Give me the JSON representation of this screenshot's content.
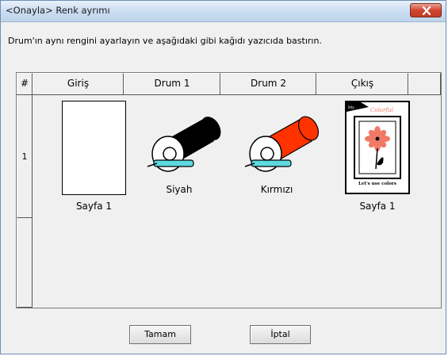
{
  "window": {
    "title": "<Onayla> Renk ayrımı"
  },
  "instruction": "Drum'ın aynı rengini ayarlayın ve aşağıdaki gibi kağıdı yazıcıda bastırın.",
  "table": {
    "headers": [
      "#",
      "Giriş",
      "Drum 1",
      "Drum 2",
      "Çıkış",
      ""
    ],
    "rows": [
      {
        "index": "1",
        "input_label": "Sayfa 1",
        "drum1_label": "Siyah",
        "drum2_label": "Kırmızı",
        "output_label": "Sayfa 1",
        "output_page": {
          "logo": "My",
          "heading": "Colorful",
          "footer": "Let's use colors"
        }
      }
    ]
  },
  "colors": {
    "drum1": "#000000",
    "drum2": "#ff3300",
    "tray": "#5fd9e0",
    "accent_red": "#f07a66"
  },
  "icons": {
    "close": "close-icon"
  },
  "buttons": {
    "ok": "Tamam",
    "cancel": "İptal"
  }
}
